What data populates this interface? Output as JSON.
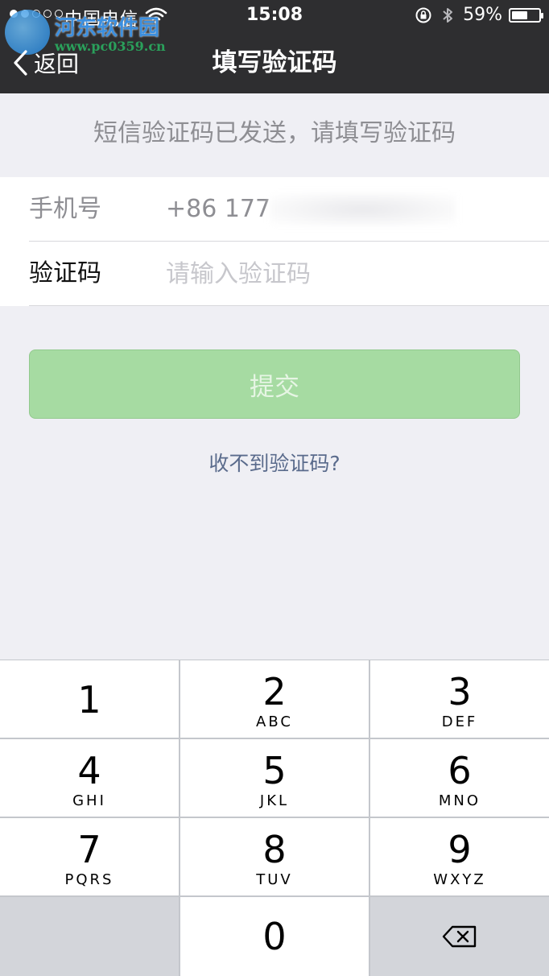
{
  "status_bar": {
    "carrier": "中国电信",
    "time": "15:08",
    "battery_percent": "59%",
    "battery_level": 0.59
  },
  "watermark": {
    "name": "河东软件园",
    "url": "www.pc0359.cn"
  },
  "nav": {
    "back_label": "返回",
    "title": "填写验证码"
  },
  "message": "短信验证码已发送，请填写验证码",
  "form": {
    "phone_label": "手机号",
    "phone_value": "+86 177",
    "code_label": "验证码",
    "code_placeholder": "请输入验证码"
  },
  "submit_label": "提交",
  "no_code_link": "收不到验证码?",
  "keypad": [
    {
      "digit": "1",
      "letters": ""
    },
    {
      "digit": "2",
      "letters": "ABC"
    },
    {
      "digit": "3",
      "letters": "DEF"
    },
    {
      "digit": "4",
      "letters": "GHI"
    },
    {
      "digit": "5",
      "letters": "JKL"
    },
    {
      "digit": "6",
      "letters": "MNO"
    },
    {
      "digit": "7",
      "letters": "PQRS"
    },
    {
      "digit": "8",
      "letters": "TUV"
    },
    {
      "digit": "9",
      "letters": "WXYZ"
    },
    {
      "digit": "0",
      "letters": ""
    }
  ],
  "colors": {
    "header_bg": "#2e2e30",
    "page_bg": "#efeff4",
    "submit_bg": "#a6dba2",
    "link_color": "#5a6b8c"
  }
}
